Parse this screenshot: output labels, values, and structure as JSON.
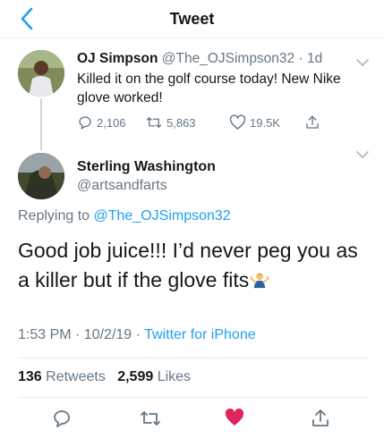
{
  "nav": {
    "title": "Tweet",
    "back_icon": "chevron-left-icon"
  },
  "parent_tweet": {
    "name": "OJ Simpson",
    "handle": "@The_OJSimpson32",
    "time": "· 1d",
    "text": "Killed it on the golf course today! New Nike glove worked!",
    "replies": "2,106",
    "retweets": "5,863",
    "likes": "19.5K"
  },
  "reply_tweet": {
    "name": "Sterling Washington",
    "handle": "@artsandfarts",
    "replying_prefix": "Replying to",
    "replying_to": "@The_OJSimpson32",
    "text": "Good job juice!!! I’d never peg you as a killer but if the glove fits",
    "time": "1:53 PM · 10/2/19 ·",
    "source": "Twitter for iPhone",
    "retweet_count": "136",
    "retweet_label": "Retweets",
    "like_count": "2,599",
    "like_label": "Likes"
  },
  "colors": {
    "accent": "#1da1f2",
    "muted": "#657786",
    "like": "#e0245e"
  }
}
